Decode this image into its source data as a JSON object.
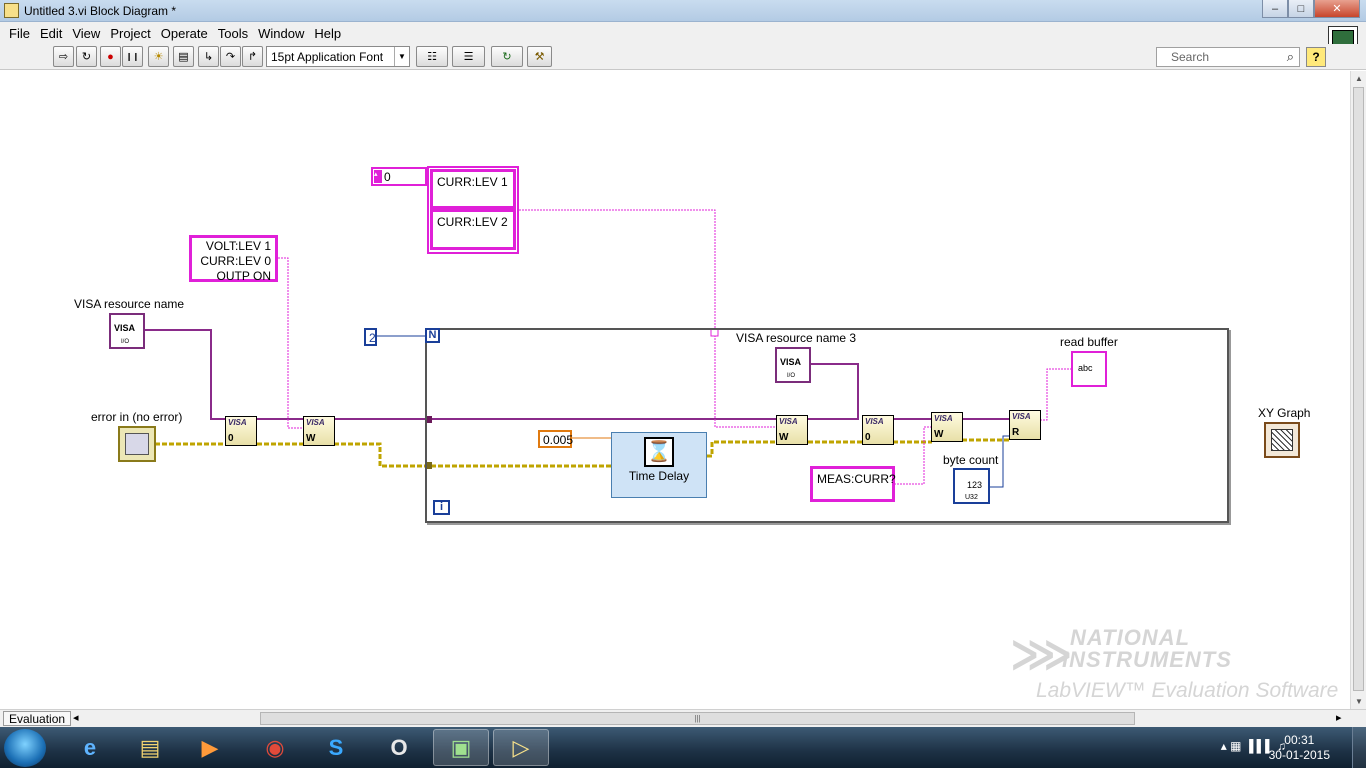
{
  "window": {
    "title": "Untitled 3.vi Block Diagram *",
    "minimize_glyph": "–",
    "maximize_glyph": "□",
    "close_glyph": "✕"
  },
  "menu": [
    "File",
    "Edit",
    "View",
    "Project",
    "Operate",
    "Tools",
    "Window",
    "Help"
  ],
  "vi_icon_number": "1",
  "toolbar": {
    "buttons": [
      {
        "name": "run-arrow-icon",
        "glyph": "⇨"
      },
      {
        "name": "run-continuously-icon",
        "glyph": "↻"
      },
      {
        "name": "abort-icon",
        "glyph": "●"
      },
      {
        "name": "pause-icon",
        "glyph": "❙❙"
      },
      {
        "name": "highlight-execution-icon",
        "glyph": "☀"
      },
      {
        "name": "retain-wire-values-icon",
        "glyph": "▤"
      },
      {
        "name": "step-into-icon",
        "glyph": "↳"
      },
      {
        "name": "step-over-icon",
        "glyph": "↷"
      },
      {
        "name": "step-out-icon",
        "glyph": "↱"
      }
    ],
    "font_select": "15pt Application Font",
    "align_glyph": "☷",
    "distribute_glyph": "☰",
    "reorder_glyph": "↻",
    "cleanup_glyph": "⚒",
    "search_placeholder": "Search",
    "search_icon": "⌕",
    "help_glyph": "?"
  },
  "diagram": {
    "string_constants": [
      {
        "id": "volt-curr-outp",
        "text": "VOLT:LEV 1\nCURR:LEV 0\nOUTP ON"
      },
      {
        "id": "curr-lev-1",
        "text": "CURR:LEV 1"
      },
      {
        "id": "curr-lev-2",
        "text": "CURR:LEV 2"
      },
      {
        "id": "meas-curr",
        "text": "MEAS:CURR?"
      }
    ],
    "labels": {
      "visa_resource_name": "VISA resource name",
      "error_in": "error in (no error)",
      "visa_resource_name_3": "VISA resource name 3",
      "read_buffer": "read buffer",
      "byte_count": "byte count",
      "xy_graph": "XY Graph",
      "time_delay": "Time Delay"
    },
    "numeric_constants": {
      "loop_count": "2",
      "delay": "0.005",
      "array_index": "0"
    },
    "loop_terminals": {
      "count": "N",
      "iteration": "i"
    },
    "subvi_texts": {
      "visa": "VISA",
      "abc": "abc",
      "w": "W",
      "r": "R",
      "zero": "0",
      "io": "I/O",
      "u32": "U32",
      "num": "123"
    },
    "watermark": {
      "line1": "NATIONAL",
      "line2": "INSTRUMENTS",
      "line3": "LabVIEW™ Evaluation Software"
    }
  },
  "status": {
    "label": "Evaluation",
    "scroll_left": "◂",
    "scroll_right": "▸",
    "scroll_grip": "|||"
  },
  "taskbar": {
    "apps": [
      {
        "name": "internet-explorer-icon",
        "glyph": "e"
      },
      {
        "name": "file-explorer-icon",
        "glyph": "▤"
      },
      {
        "name": "media-player-icon",
        "glyph": "▶"
      },
      {
        "name": "chrome-icon",
        "glyph": "◉"
      },
      {
        "name": "skype-icon",
        "glyph": "S"
      },
      {
        "name": "opera-icon",
        "glyph": "O"
      },
      {
        "name": "labview-front-panel-icon",
        "glyph": "▣"
      },
      {
        "name": "labview-block-diagram-icon",
        "glyph": "▷"
      }
    ],
    "tray_glyphs": "▴ ▦ ▐ ▌▌ ♫",
    "time": "00:31",
    "date": "30-01-2015"
  },
  "colors": {
    "string_wire": "#e020d8",
    "error_wire": "#bfa400",
    "visa_wire": "#8a2b8a",
    "numeric_blue": "#1a3f99",
    "numeric_orange": "#e07a10"
  }
}
